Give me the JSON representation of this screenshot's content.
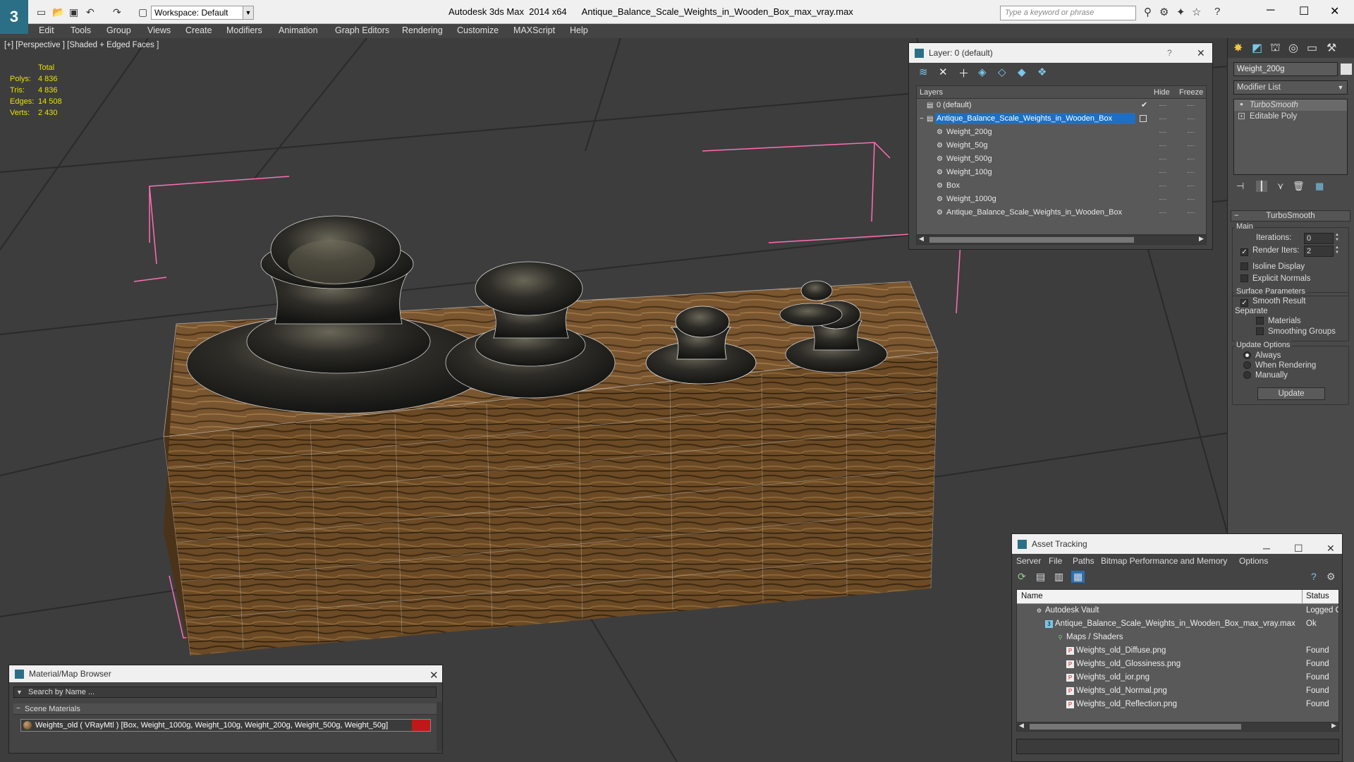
{
  "titlebar": {
    "workspace": "Workspace: Default",
    "title": "Autodesk 3ds Max  2014 x64      Antique_Balance_Scale_Weights_in_Wooden_Box_max_vray.max",
    "search_placeholder": "Type a keyword or phrase"
  },
  "menubar": {
    "items": [
      "Edit",
      "Tools",
      "Group",
      "Views",
      "Create",
      "Modifiers",
      "Animation",
      "Graph Editors",
      "Rendering",
      "Customize",
      "MAXScript",
      "Help"
    ]
  },
  "viewport": {
    "label": "[+] [Perspective ] [Shaded + Edged Faces ]",
    "stats": {
      "header": "Total",
      "rows": [
        {
          "label": "Polys:",
          "value": "4 836"
        },
        {
          "label": "Tris:",
          "value": "4 836"
        },
        {
          "label": "Edges:",
          "value": "14 508"
        },
        {
          "label": "Verts:",
          "value": "2 430"
        }
      ]
    },
    "colors": {
      "background": "#3d3d3d",
      "grid": "#2a2a2a",
      "wood": "#6a4a26",
      "metal": "#2c2c28",
      "bbox": "#ff6eb4",
      "stats": "#e6e200"
    }
  },
  "layer_panel": {
    "title": "Layer: 0 (default)",
    "help": "?",
    "columns": {
      "name": "Layers",
      "hide": "Hide",
      "freeze": "Freeze"
    },
    "rows": [
      {
        "name": "0 (default)",
        "indent": 0,
        "selected": false
      },
      {
        "name": "Antique_Balance_Scale_Weights_in_Wooden_Box",
        "indent": 0,
        "selected": true
      },
      {
        "name": "Weight_200g",
        "indent": 1,
        "selected": false
      },
      {
        "name": "Weight_50g",
        "indent": 1,
        "selected": false
      },
      {
        "name": "Weight_500g",
        "indent": 1,
        "selected": false
      },
      {
        "name": "Weight_100g",
        "indent": 1,
        "selected": false
      },
      {
        "name": "Box",
        "indent": 1,
        "selected": false
      },
      {
        "name": "Weight_1000g",
        "indent": 1,
        "selected": false
      },
      {
        "name": "Antique_Balance_Scale_Weights_in_Wooden_Box",
        "indent": 1,
        "selected": false
      }
    ]
  },
  "command_panel": {
    "object_name": "Weight_200g",
    "modifier_list": "Modifier List",
    "stack": [
      "TurboSmooth",
      "Editable Poly"
    ],
    "rollout": {
      "title": "TurboSmooth",
      "main": "Main",
      "iterations_label": "Iterations:",
      "iterations": "0",
      "render_iters_label": "Render Iters:",
      "render_iters": "2",
      "isoline": "Isoline Display",
      "explicit": "Explicit Normals",
      "surface": "Surface Parameters",
      "smooth_result": "Smooth Result",
      "separate": "Separate",
      "materials": "Materials",
      "smoothing_groups": "Smoothing Groups",
      "update_options": "Update Options",
      "always": "Always",
      "when_rendering": "When Rendering",
      "manually": "Manually",
      "update": "Update"
    }
  },
  "asset_panel": {
    "title": "Asset Tracking",
    "menu": [
      "Server",
      "File",
      "Paths",
      "Bitmap Performance and Memory",
      "Options"
    ],
    "columns": {
      "name": "Name",
      "status": "Status"
    },
    "rows": [
      {
        "name": "Autodesk Vault",
        "status": "Logged O",
        "level": 1,
        "icon": "vault-icon"
      },
      {
        "name": "Antique_Balance_Scale_Weights_in_Wooden_Box_max_vray.max",
        "status": "Ok",
        "level": 2,
        "icon": "max-file-icon"
      },
      {
        "name": "Maps / Shaders",
        "status": "",
        "level": 3,
        "icon": "maps-icon"
      },
      {
        "name": "Weights_old_Diffuse.png",
        "status": "Found",
        "level": 4,
        "icon": "png-icon"
      },
      {
        "name": "Weights_old_Glossiness.png",
        "status": "Found",
        "level": 4,
        "icon": "png-icon"
      },
      {
        "name": "Weights_old_ior.png",
        "status": "Found",
        "level": 4,
        "icon": "png-icon"
      },
      {
        "name": "Weights_old_Normal.png",
        "status": "Found",
        "level": 4,
        "icon": "png-icon"
      },
      {
        "name": "Weights_old_Reflection.png",
        "status": "Found",
        "level": 4,
        "icon": "png-icon"
      }
    ]
  },
  "material_panel": {
    "title": "Material/Map Browser",
    "search_placeholder": "Search by Name ...",
    "group": "Scene Materials",
    "item": "Weights_old  ( VRayMtl ) [Box, Weight_1000g, Weight_100g, Weight_200g, Weight_500g, Weight_50g]"
  }
}
